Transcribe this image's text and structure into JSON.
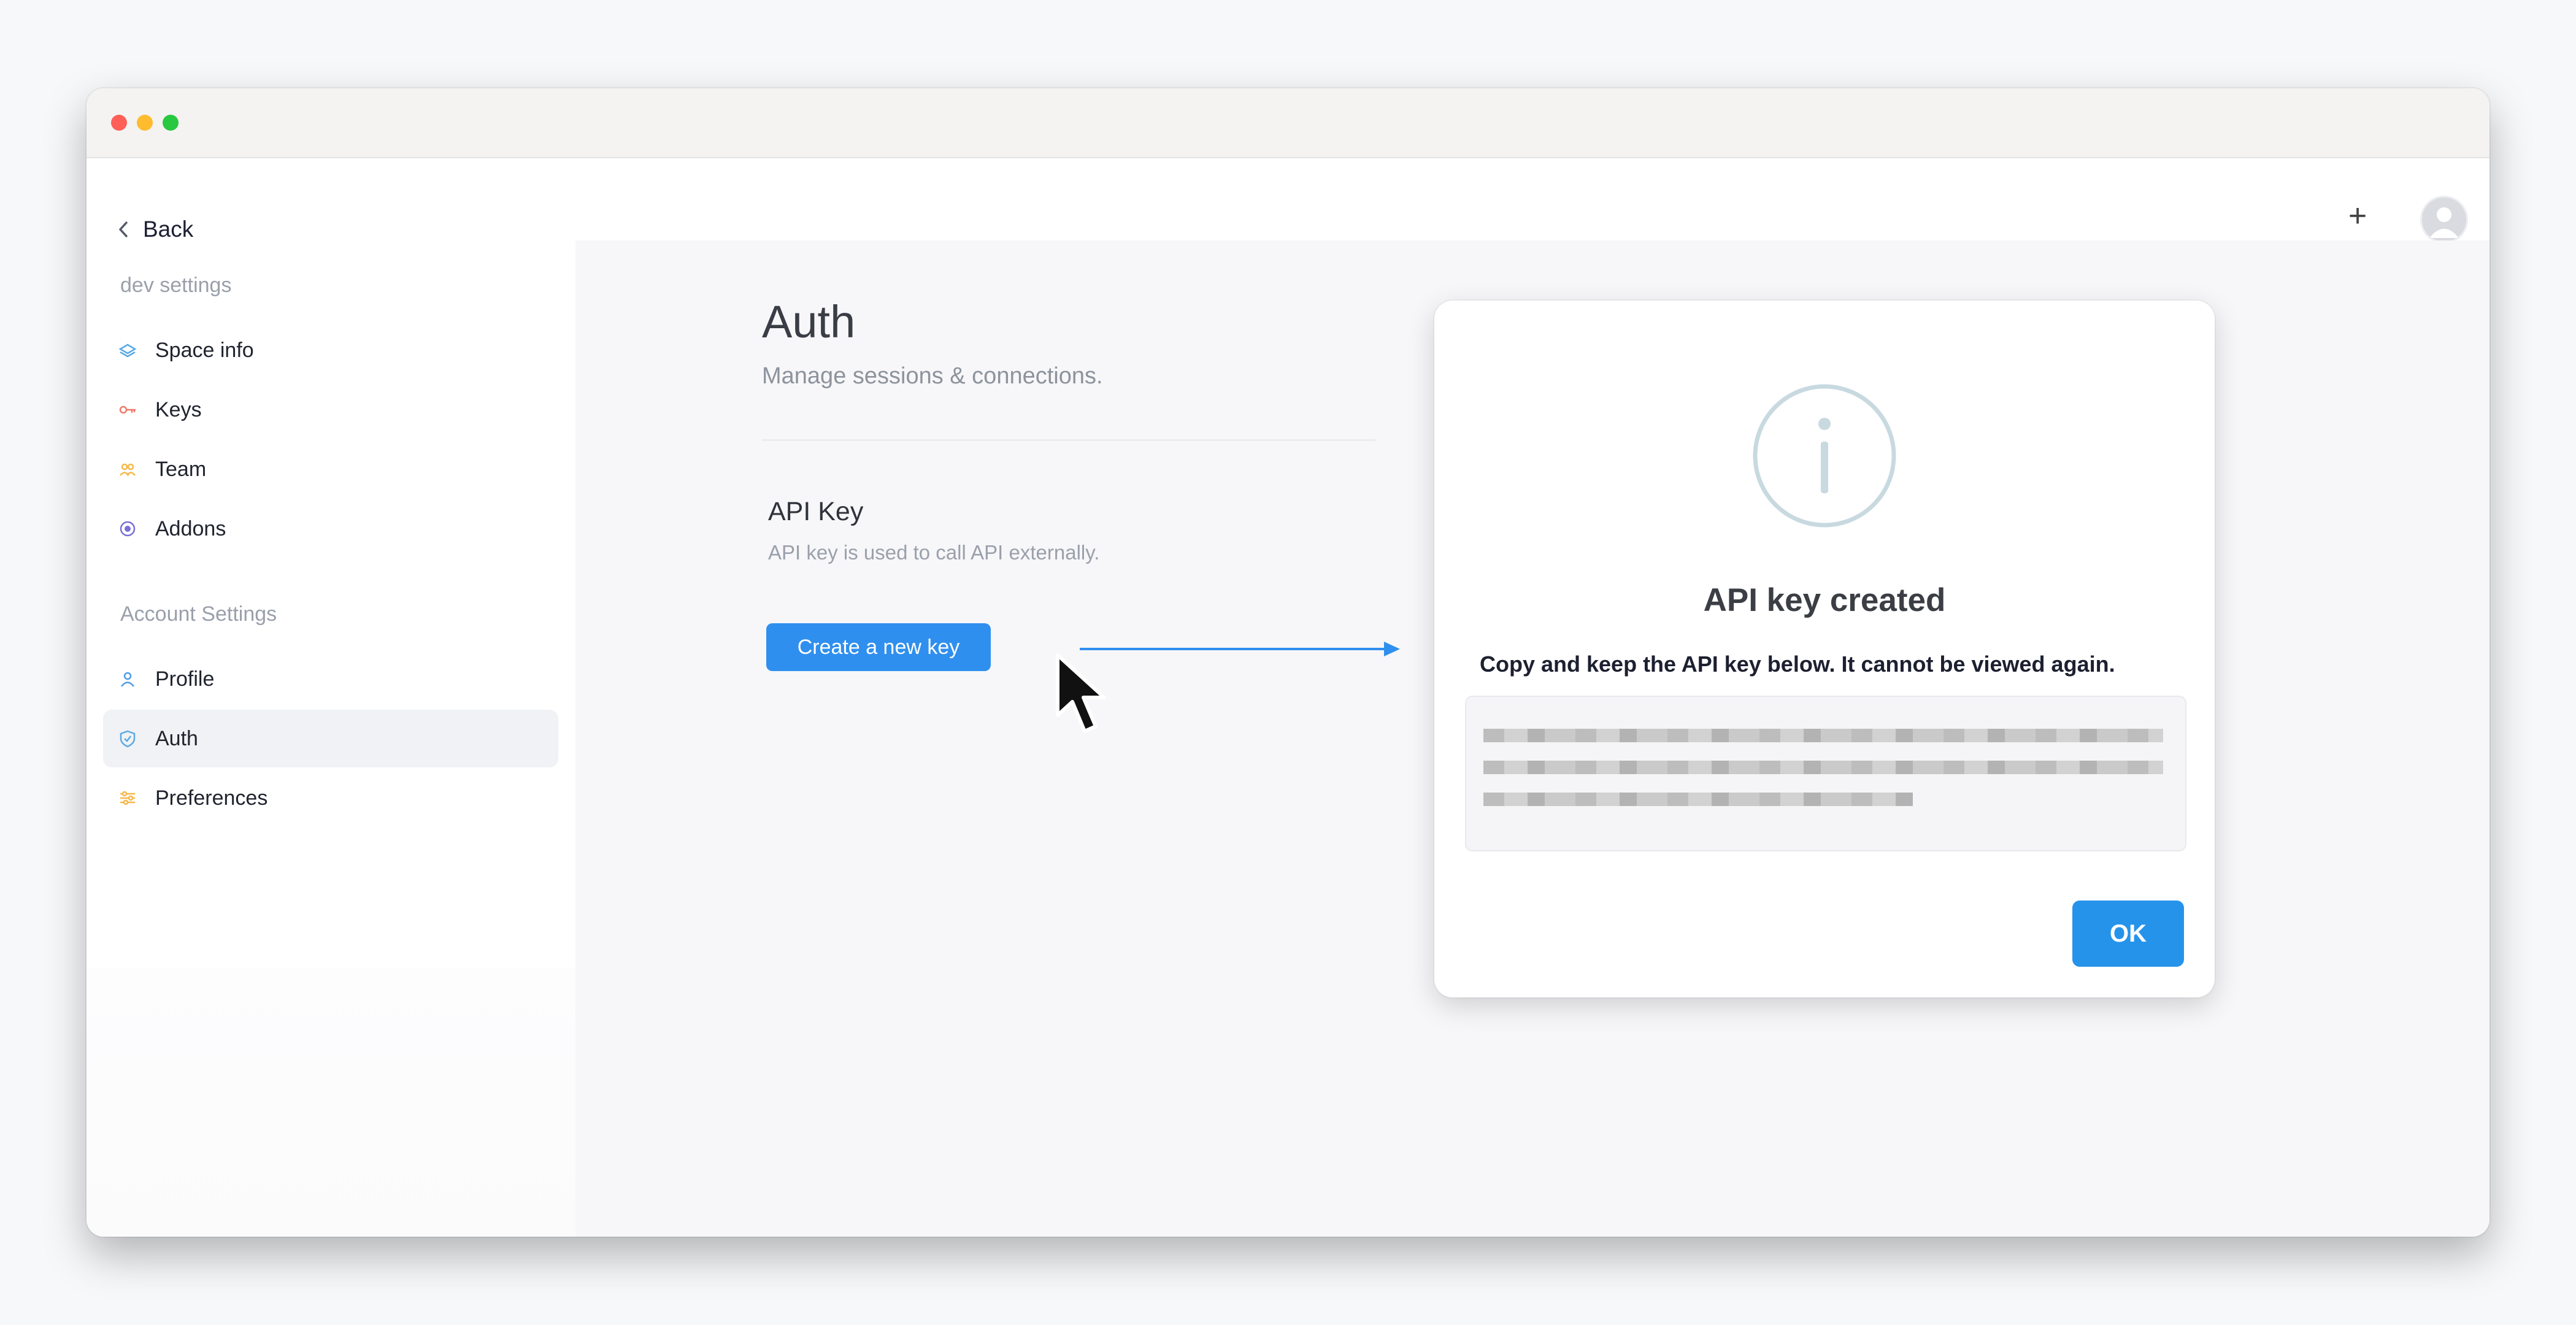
{
  "sidebar": {
    "back_label": "Back",
    "dev_section_label": "dev settings",
    "dev_items": [
      {
        "label": "Space info",
        "icon": "layers-icon",
        "color": "#5aa9e6"
      },
      {
        "label": "Keys",
        "icon": "key-icon",
        "color": "#f07a6a"
      },
      {
        "label": "Team",
        "icon": "team-icon",
        "color": "#f5b84a"
      },
      {
        "label": "Addons",
        "icon": "addon-icon",
        "color": "#7b6fd6"
      }
    ],
    "account_section_label": "Account Settings",
    "account_items": [
      {
        "label": "Profile",
        "icon": "user-icon",
        "color": "#4f9be6"
      },
      {
        "label": "Auth",
        "icon": "shield-icon",
        "color": "#5aa9e6",
        "active": true
      },
      {
        "label": "Preferences",
        "icon": "sliders-icon",
        "color": "#f5b84a"
      }
    ]
  },
  "topbar": {
    "plus_glyph": "+",
    "avatar_icon": "avatar-icon"
  },
  "main": {
    "title": "Auth",
    "subtitle": "Manage sessions & connections.",
    "api_key_title": "API Key",
    "api_key_desc": "API key is used to call API externally.",
    "create_button_label": "Create a new key"
  },
  "modal": {
    "icon": "info-icon",
    "title": "API key created",
    "message": "Copy and keep the API key below. It cannot be viewed again.",
    "ok_label": "OK"
  },
  "colors": {
    "accent": "#2f8fee",
    "ok_button": "#2693eb"
  }
}
